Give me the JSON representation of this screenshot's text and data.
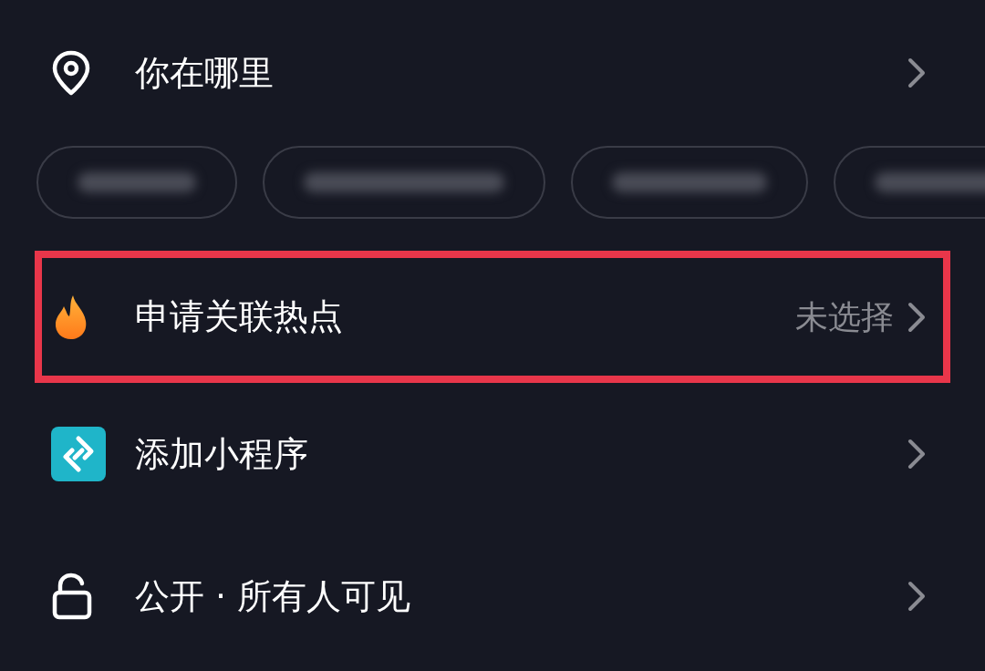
{
  "rows": [
    {
      "kind": "location",
      "label": "你在哪里"
    },
    {
      "kind": "chips",
      "chips": [
        {
          "kind": "blurred"
        },
        {
          "kind": "blurred"
        },
        {
          "kind": "blurred"
        },
        {
          "kind": "blurred"
        }
      ]
    },
    {
      "kind": "hotspot",
      "label": "申请关联热点",
      "value": "未选择",
      "highlighted": true
    },
    {
      "kind": "miniprogram",
      "label": "添加小程序"
    },
    {
      "kind": "privacy",
      "label": "公开 · 所有人可见"
    }
  ]
}
